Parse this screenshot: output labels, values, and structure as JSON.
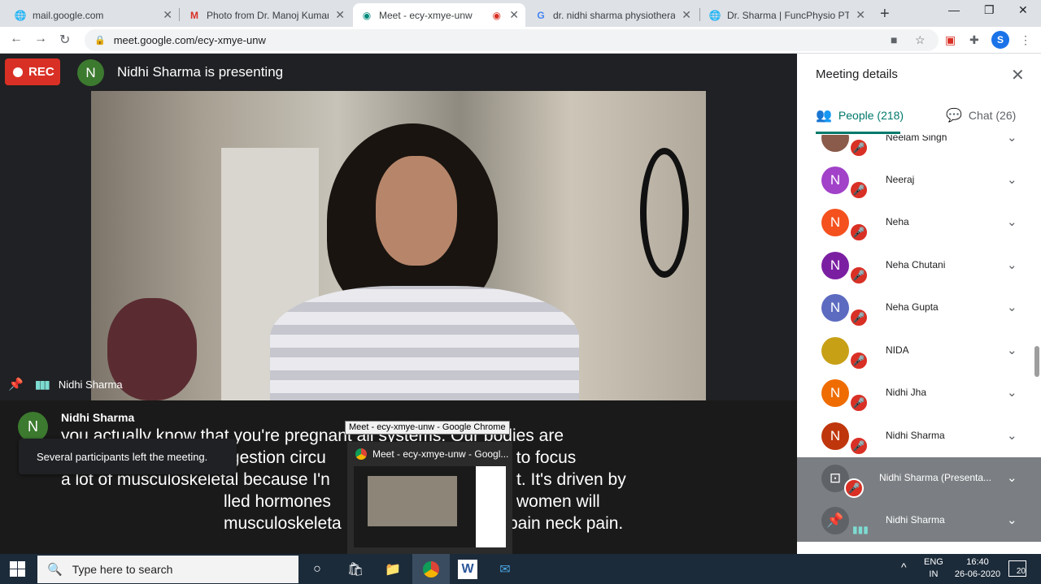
{
  "browser": {
    "tabs": [
      {
        "label": "mail.google.com",
        "icon": "globe-icon"
      },
      {
        "label": "Photo from Dr. Manoj Kumar S",
        "icon": "gmail-icon"
      },
      {
        "label": "Meet - ecy-xmye-unw",
        "icon": "meet-icon",
        "active": true
      },
      {
        "label": "dr. nidhi sharma physiotherapi",
        "icon": "google-icon"
      },
      {
        "label": "Dr. Sharma | FuncPhysio PT",
        "icon": "globe-icon"
      }
    ],
    "url": "meet.google.com/ecy-xmye-unw",
    "profile_initial": "S"
  },
  "meet": {
    "rec_label": "REC",
    "presenter_initial": "N",
    "presenting_text": "Nidhi Sharma is presenting",
    "tile_name": "Nidhi Sharma",
    "caption": {
      "speaker_initial": "N",
      "speaker": "Nidhi Sharma",
      "lines": [
        "you actually know that you're pregnant all systems. Our bodies are",
        "affected whether it's digestion circu",
        "a lot of musculoskeletal because I'n",
        "lled hormones",
        "musculoskeleta"
      ],
      "line_tails": [
        "",
        "n going to focus",
        "t. It's driven by",
        "women will",
        "pain neck pain."
      ]
    },
    "toast": "Several participants left the meeting.",
    "tooltip": "Meet - ecy-xmye-unw - Google Chrome",
    "thumb_title": "Meet - ecy-xmye-unw - Googl..."
  },
  "panel": {
    "title": "Meeting details",
    "people_tab": "People (218)",
    "chat_tab": "Chat (26)",
    "people": [
      {
        "name": "Neelam Singh",
        "initial": "",
        "color": "#8a5a4a"
      },
      {
        "name": "Neeraj",
        "initial": "N",
        "color": "#a142c9"
      },
      {
        "name": "Neha",
        "initial": "N",
        "color": "#f4511e"
      },
      {
        "name": "Neha Chutani",
        "initial": "N",
        "color": "#7b1fa2"
      },
      {
        "name": "Neha Gupta",
        "initial": "N",
        "color": "#5c6bc0"
      },
      {
        "name": "NIDA",
        "initial": "",
        "color": "#c8a016"
      },
      {
        "name": "Nidhi Jha",
        "initial": "N",
        "color": "#ef6c00"
      },
      {
        "name": "Nidhi Sharma",
        "initial": "N",
        "color": "#bf360c"
      },
      {
        "name": "Nidhi Sharma (Presenta...",
        "initial": "",
        "color": "#5f6368"
      },
      {
        "name": "Nidhi Sharma",
        "initial": "",
        "color": "#5f6368"
      }
    ]
  },
  "taskbar": {
    "search_placeholder": "Type here to search",
    "lang": "ENG",
    "region": "IN",
    "time": "16:40",
    "date": "26-06-2020",
    "notif_count": "20"
  }
}
